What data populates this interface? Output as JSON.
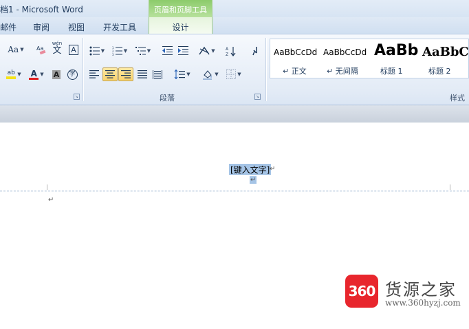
{
  "window": {
    "title": "档1 - Microsoft Word",
    "context_tab_group": "页眉和页脚工具"
  },
  "tabs": {
    "mailings": "邮件",
    "review": "审阅",
    "view": "视图",
    "developer": "开发工具",
    "design": "设计"
  },
  "ribbon": {
    "font": {
      "change_case_label": "Aa",
      "phonetic_guide_top": "wén",
      "phonetic_guide_char": "文",
      "char_border_label": "A",
      "highlight_label": "ab",
      "font_color_label": "A",
      "char_shading_label": "A",
      "enclose_char_label": "字"
    },
    "paragraph": {
      "group_label": "段落"
    },
    "styles": {
      "group_label": "样式",
      "items": [
        {
          "sample": "AaBbCcDd",
          "name": "↵ 正文"
        },
        {
          "sample": "AaBbCcDd",
          "name": "↵ 无间隔"
        },
        {
          "sample": "AaBb",
          "name": "标题 1"
        },
        {
          "sample": "AaBbC",
          "name": "标题 2"
        }
      ]
    }
  },
  "document": {
    "header_placeholder": "[键入文字]",
    "paragraph_mark": "↵"
  },
  "watermark": {
    "logo_text": "360",
    "title": "货源之家",
    "url": "www.360hyzj.com"
  },
  "colors": {
    "context_tab": "#8ccb6b",
    "selection": "#a5c4e6",
    "active_button": "#f9d26c",
    "font_color_bar": "#e02020",
    "highlight_bar": "#f5e31a",
    "watermark_logo": "#e8262d"
  }
}
